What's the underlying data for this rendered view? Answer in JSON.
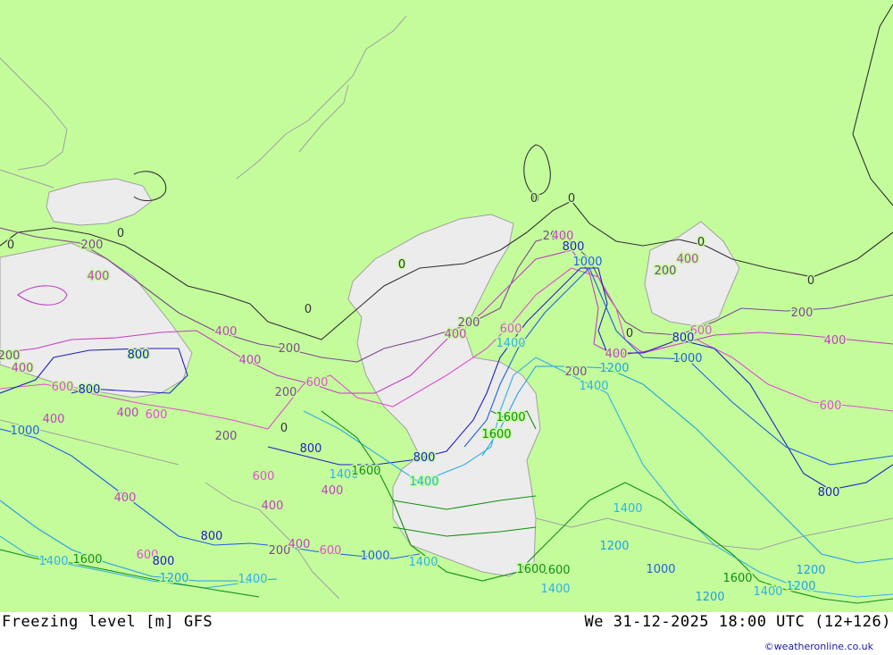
{
  "title": {
    "product": "Freezing level [m] GFS",
    "datetime": "We 31-12-2025 18:00 UTC (12+126)"
  },
  "credit": "©weatheronline.co.uk",
  "colors": {
    "land": "#c4fc9c",
    "water": "#ececec",
    "coast": "#a0a0a0",
    "c0": "#333333",
    "c200": "#7a4a8a",
    "c400": "#c040c0",
    "c600": "#e050d0",
    "c800": "#2020c0",
    "c1000": "#2060e0",
    "c1200": "#20a0e0",
    "c1400": "#30b0e8",
    "c1600": "#109010"
  },
  "contour_labels": [
    {
      "text": "0",
      "level": "c0"
    },
    {
      "text": "0",
      "level": "c0"
    },
    {
      "text": "0",
      "level": "c0"
    },
    {
      "text": "0",
      "level": "c0"
    },
    {
      "text": "0",
      "level": "c0"
    },
    {
      "text": "0",
      "level": "c0"
    },
    {
      "text": "0",
      "level": "c0"
    },
    {
      "text": "0",
      "level": "c0"
    },
    {
      "text": "0",
      "level": "c0"
    },
    {
      "text": "0",
      "level": "c0"
    },
    {
      "text": "0",
      "level": "c0"
    },
    {
      "text": "200",
      "level": "c200"
    },
    {
      "text": "200",
      "level": "c200"
    },
    {
      "text": "200",
      "level": "c200"
    },
    {
      "text": "200",
      "level": "c200"
    },
    {
      "text": "200",
      "level": "c200"
    },
    {
      "text": "200",
      "level": "c200"
    },
    {
      "text": "200",
      "level": "c200"
    },
    {
      "text": "200",
      "level": "c200"
    },
    {
      "text": "200",
      "level": "c200"
    },
    {
      "text": "200",
      "level": "c200"
    },
    {
      "text": "200",
      "level": "c200"
    },
    {
      "text": "400",
      "level": "c400"
    },
    {
      "text": "400",
      "level": "c400"
    },
    {
      "text": "400",
      "level": "c400"
    },
    {
      "text": "400",
      "level": "c400"
    },
    {
      "text": "400",
      "level": "c400"
    },
    {
      "text": "400",
      "level": "c400"
    },
    {
      "text": "400",
      "level": "c400"
    },
    {
      "text": "400",
      "level": "c400"
    },
    {
      "text": "400",
      "level": "c400"
    },
    {
      "text": "400",
      "level": "c400"
    },
    {
      "text": "400",
      "level": "c400"
    },
    {
      "text": "400",
      "level": "c400"
    },
    {
      "text": "400",
      "level": "c400"
    },
    {
      "text": "400",
      "level": "c400"
    },
    {
      "text": "400",
      "level": "c400"
    },
    {
      "text": "600",
      "level": "c600"
    },
    {
      "text": "600",
      "level": "c600"
    },
    {
      "text": "600",
      "level": "c600"
    },
    {
      "text": "600",
      "level": "c600"
    },
    {
      "text": "600",
      "level": "c600"
    },
    {
      "text": "600",
      "level": "c600"
    },
    {
      "text": "600",
      "level": "c600"
    },
    {
      "text": "600",
      "level": "c600"
    },
    {
      "text": "600",
      "level": "c600"
    },
    {
      "text": "600",
      "level": "c600"
    },
    {
      "text": "800",
      "level": "c800"
    },
    {
      "text": "800",
      "level": "c800"
    },
    {
      "text": "800",
      "level": "c800"
    },
    {
      "text": "800",
      "level": "c800"
    },
    {
      "text": "800",
      "level": "c800"
    },
    {
      "text": "800",
      "level": "c800"
    },
    {
      "text": "800",
      "level": "c800"
    },
    {
      "text": "800",
      "level": "c800"
    },
    {
      "text": "800",
      "level": "c800"
    },
    {
      "text": "1000",
      "level": "c1000"
    },
    {
      "text": "1000",
      "level": "c1000"
    },
    {
      "text": "1000",
      "level": "c1000"
    },
    {
      "text": "1000",
      "level": "c1000"
    },
    {
      "text": "1000",
      "level": "c1000"
    },
    {
      "text": "1200",
      "level": "c1200"
    },
    {
      "text": "1200",
      "level": "c1200"
    },
    {
      "text": "1200",
      "level": "c1200"
    },
    {
      "text": "1200",
      "level": "c1200"
    },
    {
      "text": "1200",
      "level": "c1200"
    },
    {
      "text": "1200",
      "level": "c1200"
    },
    {
      "text": "1200",
      "level": "c1200"
    },
    {
      "text": "1400",
      "level": "c1400"
    },
    {
      "text": "1400",
      "level": "c1400"
    },
    {
      "text": "1400",
      "level": "c1400"
    },
    {
      "text": "1400",
      "level": "c1400"
    },
    {
      "text": "1400",
      "level": "c1400"
    },
    {
      "text": "1400",
      "level": "c1400"
    },
    {
      "text": "1400",
      "level": "c1400"
    },
    {
      "text": "1400",
      "level": "c1400"
    },
    {
      "text": "1400",
      "level": "c1400"
    },
    {
      "text": "1400",
      "level": "c1400"
    },
    {
      "text": "1600",
      "level": "c1600"
    },
    {
      "text": "1600",
      "level": "c1600"
    },
    {
      "text": "1600",
      "level": "c1600"
    },
    {
      "text": "1600",
      "level": "c1600"
    },
    {
      "text": "1600",
      "level": "c1600"
    },
    {
      "text": "1600",
      "level": "c1600"
    },
    {
      "text": "1600",
      "level": "c1600"
    }
  ]
}
